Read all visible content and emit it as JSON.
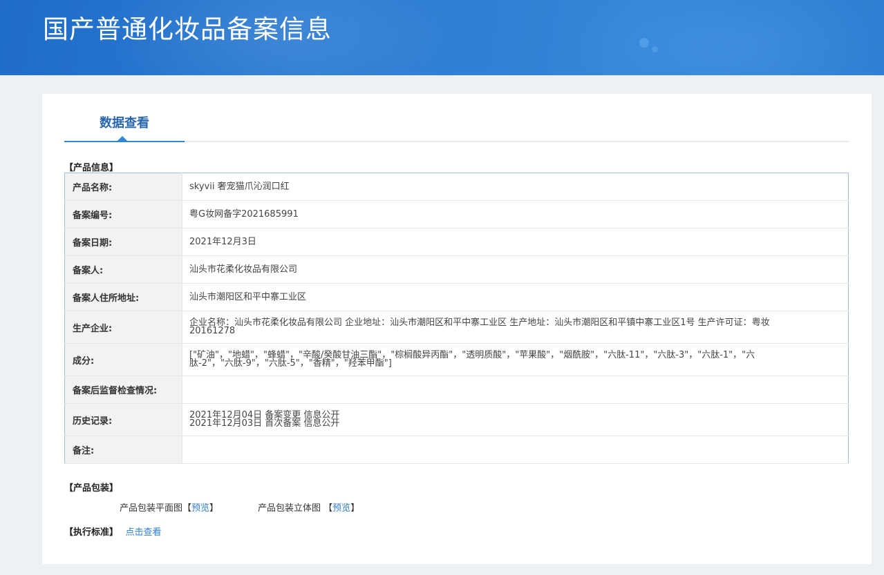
{
  "header": {
    "title": "国产普通化妆品备案信息"
  },
  "tabs": [
    {
      "label": "数据查看"
    }
  ],
  "product_info": {
    "section_label": "【产品信息】",
    "rows": [
      {
        "label": "产品名称:",
        "lines": [
          "skyvii 奢宠猫爪沁润口红"
        ]
      },
      {
        "label": "备案编号:",
        "lines": [
          "粤G妆网备字2021685991"
        ]
      },
      {
        "label": "备案日期:",
        "lines": [
          "2021年12月3日"
        ]
      },
      {
        "label": "备案人:",
        "lines": [
          "汕头市花柔化妆品有限公司"
        ]
      },
      {
        "label": "备案人住所地址:",
        "lines": [
          "汕头市潮阳区和平中寨工业区"
        ]
      },
      {
        "label": "生产企业:",
        "lines": [
          "企业名称：汕头市花柔化妆品有限公司 企业地址：汕头市潮阳区和平中寨工业区 生产地址：汕头市潮阳区和平镇中寨工业区1号 生产许可证：粤妆",
          "20161278"
        ]
      },
      {
        "label": "成分:",
        "lines": [
          "[\"矿油\"，\"地蜡\"，\"蜂蜡\"，\"辛酸/癸酸甘油三酯\"，\"棕榈酸异丙酯\"，\"透明质酸\"，\"苹果酸\"，\"烟酰胺\"，\"六肽-11\"，\"六肽-3\"，\"六肽-1\"，\"六",
          "肽-2\"，\"六肽-9\"，\"六肽-5\"，\"香精\"，\"羟苯甲酯\"]"
        ]
      },
      {
        "label": "备案后监督检查情况:",
        "lines": []
      },
      {
        "label": "历史记录:",
        "lines": [
          "2021年12月04日 备案变更 信息公开",
          "2021年12月03日 首次备案 信息公开"
        ]
      },
      {
        "label": "备注:",
        "lines": []
      }
    ]
  },
  "packaging": {
    "section_label": "【产品包装】",
    "flat_label": "产品包装平面图",
    "flat_link": "预览",
    "solid_label": "产品包装立体图",
    "solid_link": "预览",
    "bracket_open": "【",
    "bracket_close": "】"
  },
  "standard": {
    "section_label": "【执行标准】",
    "link": "点击查看"
  }
}
